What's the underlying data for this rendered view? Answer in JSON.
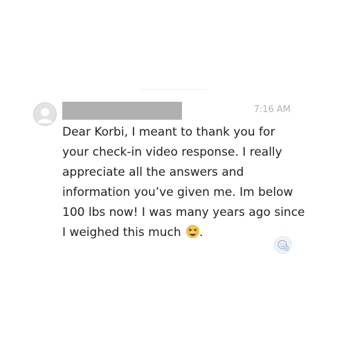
{
  "message": {
    "sender_name": "[redacted]",
    "timestamp": "7:16 AM",
    "lines": [
      "Dear Korbi, I meant to thank you for",
      "your check-in video response. I really",
      "appreciate all the answers and",
      "information you’ve given me. Im below",
      "100 lbs now! I was many years ago since",
      "I weighed this much"
    ],
    "trailing_punctuation": ".",
    "emoji": "grinning-squinting-face"
  },
  "icons": {
    "avatar": "default-user-avatar-icon",
    "reaction": "add-reaction-icon"
  },
  "colors": {
    "redaction_bar": "#b0b0b0",
    "timestamp": "#b3b3b3",
    "text": "#222222",
    "avatar_bg": "#e3e3e3"
  }
}
